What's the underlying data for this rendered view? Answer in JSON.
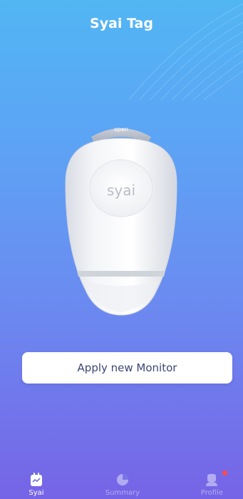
{
  "header": {
    "title": "Syai Tag"
  },
  "device": {
    "open_label": "open",
    "brand_label": "syai"
  },
  "actions": {
    "apply_label": "Apply new Monitor"
  },
  "tabbar": {
    "tabs": [
      {
        "label": "Syai",
        "icon": "monitor-icon",
        "active": true
      },
      {
        "label": "Summary",
        "icon": "pie-chart-icon",
        "active": false
      },
      {
        "label": "Profile",
        "icon": "profile-icon",
        "active": false,
        "badge": true
      }
    ]
  },
  "colors": {
    "gradient_top": "#52b6f3",
    "gradient_bottom": "#7664e6",
    "button_text": "#3b4677",
    "badge": "#ff4a4a"
  }
}
